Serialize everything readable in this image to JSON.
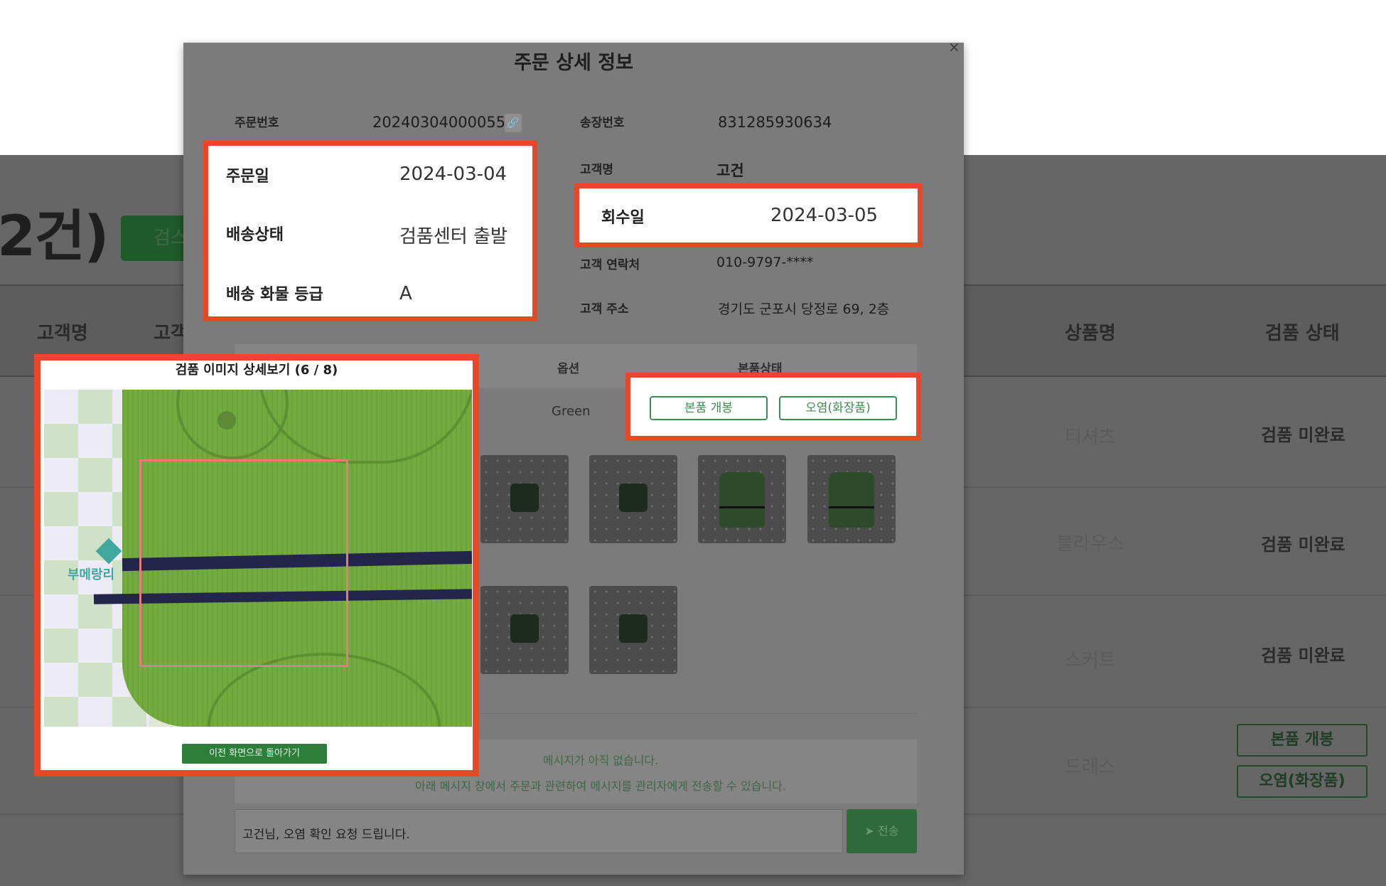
{
  "background": {
    "result_count": "2건)",
    "search_button": "검스",
    "columns": [
      "고객명",
      "고객",
      "상품명",
      "검품 상태"
    ],
    "rows": [
      {
        "product": "티셔츠",
        "status": "검품 미완료"
      },
      {
        "product": "블라우스",
        "status": "검품 미완료"
      },
      {
        "product": "스커트",
        "status": "검품 미완료"
      },
      {
        "product": "드레스",
        "status_buttons": [
          "본품 개봉",
          "오염(화장품)"
        ]
      }
    ]
  },
  "modal": {
    "title": "주문 상세 정보",
    "close": "×",
    "order_no_label": "주문번호",
    "order_no": "20240304000055",
    "link_icon": "🔗",
    "invoice_label": "송장번호",
    "invoice": "831285930634",
    "customer_label": "고객명",
    "customer": "고건",
    "order_date_label": "주문일",
    "order_date": "2024-03-04",
    "delivery_status_label": "배송상태",
    "delivery_status": "검품센터 출발",
    "cargo_grade_label": "배송 화물 등급",
    "cargo_grade": "A",
    "return_date_label": "회수일",
    "return_date": "2024-03-05",
    "contact_label": "고객 연락처",
    "contact": "010-9797-****",
    "address_label": "고객 주소",
    "address": "경기도 군포시 당정로 69, 2층",
    "table": {
      "option_header": "옵션",
      "status_header": "본품상태",
      "option_value": "Green",
      "status_buttons": [
        "본품 개봉",
        "오염(화장품)"
      ]
    },
    "messages": {
      "empty_line_1": "메시지가 아직 없습니다.",
      "empty_line_2": "아래 메시지 창에서 주문과 관련하여 메시지를 관리자에게 전송할 수 있습니다.",
      "input_value": "고건님, 오염 확인 요청 드립니다.",
      "send_label": "➤ 전송"
    }
  },
  "viewer": {
    "title": "검품 이미지 상세보기 (6 / 8)",
    "brand": "부메랑리",
    "back_button": "이전 화면으로 돌아가기"
  }
}
